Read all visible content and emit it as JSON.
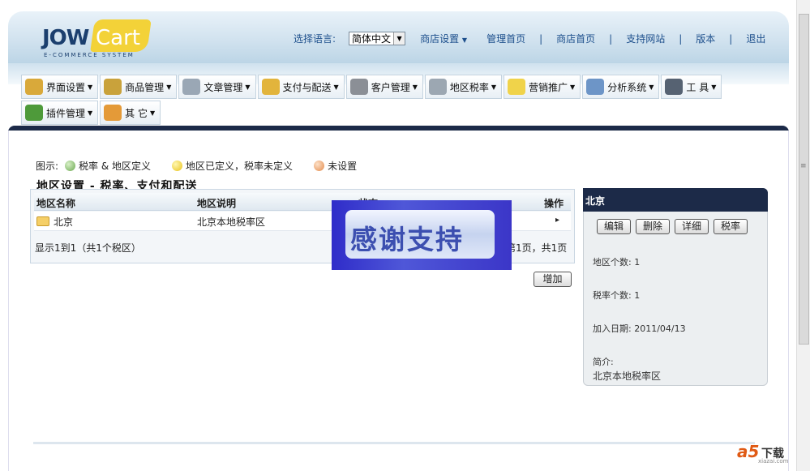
{
  "brand": {
    "logo_text_left": "JOW",
    "logo_text_right": "Cart",
    "logo_tagline": "E-COMMERCE SYSTEM"
  },
  "topnav": {
    "language_label": "选择语言:",
    "language_value": "简体中文",
    "links": [
      "商店设置",
      "管理首页",
      "商店首页",
      "支持网站",
      "版本",
      "退出"
    ]
  },
  "menu": {
    "row1": [
      {
        "label": "界面设置",
        "icon": "monitor-icon",
        "color": "#d9a93a"
      },
      {
        "label": "商品管理",
        "icon": "products-icon",
        "color": "#c9a23b"
      },
      {
        "label": "文章管理",
        "icon": "pen-icon",
        "color": "#9aa7b5"
      },
      {
        "label": "支付与配送",
        "icon": "box-icon",
        "color": "#e2b43c"
      },
      {
        "label": "客户管理",
        "icon": "user-icon",
        "color": "#8b8f96"
      },
      {
        "label": "地区税率",
        "icon": "document-icon",
        "color": "#9ca7b2"
      },
      {
        "label": "营销推广",
        "icon": "lightbulb-icon",
        "color": "#f0d34a"
      },
      {
        "label": "分析系统",
        "icon": "chart-icon",
        "color": "#6d95c7"
      },
      {
        "label": "工 具",
        "icon": "tools-icon",
        "color": "#566272"
      }
    ],
    "row2": [
      {
        "label": "插件管理",
        "icon": "plugin-icon",
        "color": "#4e9a3a"
      },
      {
        "label": "其 它",
        "icon": "pencil-icon",
        "color": "#e49a38"
      }
    ]
  },
  "legend": {
    "prefix": "图示:",
    "items": [
      "税率 & 地区定义",
      "地区已定义，税率未定义",
      "未设置"
    ]
  },
  "page_title": "地区设置 - 税率、支付和配送",
  "grid": {
    "columns": [
      "地区名称",
      "地区说明",
      "状态",
      "操作"
    ],
    "rows": [
      {
        "name": "北京",
        "description": "北京本地税率区",
        "action": "▸"
      }
    ],
    "footer_left": "显示1到1（共1个税区）",
    "footer_right": "第1页，共1页"
  },
  "add_button": "增加",
  "overlay_text": "感谢支持",
  "detail": {
    "title": "北京",
    "buttons": [
      "编辑",
      "删除",
      "详细",
      "税率"
    ],
    "zone_count": "地区个数: 1",
    "tax_count": "税率个数: 1",
    "date_added": "加入日期: 2011/04/13",
    "intro_label": "简介:",
    "intro_text": "北京本地税率区"
  },
  "watermark": {
    "brand": "a5",
    "text": "下载",
    "site": "xiazai.com"
  }
}
